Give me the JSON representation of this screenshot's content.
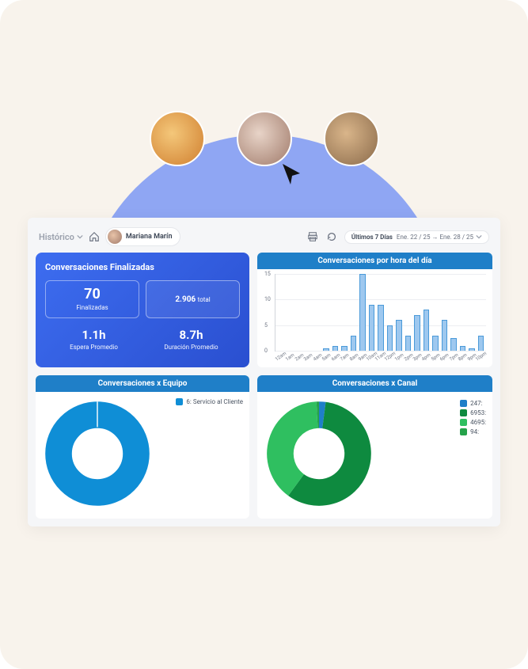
{
  "topbar": {
    "historico_label": "Histórico",
    "user_name": "Mariana Marín",
    "date_label": "Últimos 7 Días",
    "date_range": "Ene. 22 / 25 → Ene. 28 / 25"
  },
  "kpi_card": {
    "title": "Conversaciones Finalizadas",
    "finalizadas_value": "70",
    "finalizadas_label": "Finalizadas",
    "total_value": "2.906",
    "total_label": "total",
    "wait_value": "1.1h",
    "wait_label": "Espera Promedio",
    "duration_value": "8.7h",
    "duration_label": "Duración Promedio"
  },
  "hourly": {
    "title": "Conversaciones por hora del día"
  },
  "team": {
    "title": "Conversaciones x Equipo",
    "legend_prefix": "6:",
    "legend_name": "Servicio al Cliente"
  },
  "channel": {
    "title": "Conversaciones x Canal",
    "items": [
      {
        "label": "247:",
        "color": "#1f7fc8"
      },
      {
        "label": "6953:",
        "color": "#0e8a3f"
      },
      {
        "label": "4695:",
        "color": "#2fbf60"
      },
      {
        "label": "94:",
        "color": "#25a24a"
      }
    ]
  },
  "chart_data": [
    {
      "type": "bar",
      "title": "Conversaciones por hora del día",
      "ylim": [
        0,
        15
      ],
      "yticks": [
        0,
        5,
        10,
        15
      ],
      "categories": [
        "12am",
        "1am",
        "2am",
        "3am",
        "4am",
        "5am",
        "6am",
        "7am",
        "8am",
        "9am",
        "10am",
        "11am",
        "12pm",
        "1pm",
        "2pm",
        "3pm",
        "4pm",
        "5pm",
        "6pm",
        "7pm",
        "8pm",
        "9pm",
        "10pm"
      ],
      "values": [
        0,
        0,
        0,
        0,
        0,
        0.5,
        1,
        1,
        3,
        15,
        9,
        9,
        5,
        6,
        3,
        7,
        8,
        3,
        6,
        2.5,
        1,
        0.5,
        3
      ]
    },
    {
      "type": "donut",
      "title": "Conversaciones x Equipo",
      "series": [
        {
          "name": "Servicio al Cliente",
          "value": 6,
          "color": "#0f8ed6"
        }
      ]
    },
    {
      "type": "donut",
      "title": "Conversaciones x Canal",
      "series": [
        {
          "name": "247",
          "value": 247,
          "color": "#1f7fc8"
        },
        {
          "name": "6953",
          "value": 6953,
          "color": "#0e8a3f"
        },
        {
          "name": "4695",
          "value": 4695,
          "color": "#2fbf60"
        },
        {
          "name": "94",
          "value": 94,
          "color": "#25a24a"
        }
      ]
    }
  ]
}
